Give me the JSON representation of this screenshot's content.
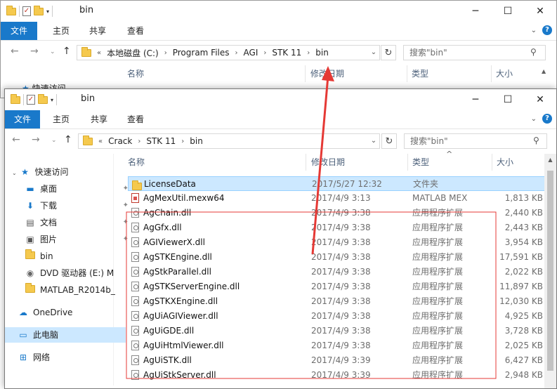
{
  "back_window": {
    "title": "bin",
    "ribbon_tabs": [
      "文件",
      "主页",
      "共享",
      "查看"
    ],
    "address_root_chevron": "«",
    "address": [
      "本地磁盘 (C:)",
      "Program Files",
      "AGI",
      "STK 11",
      "bin"
    ],
    "search_placeholder": "搜索\"bin\"",
    "columns": [
      "名称",
      "修改日期",
      "类型",
      "大小"
    ],
    "sidebar_partial": "快速访问"
  },
  "front_window": {
    "title": "bin",
    "ribbon_tabs": [
      "文件",
      "主页",
      "共享",
      "查看"
    ],
    "address_root_chevron": "«",
    "address": [
      "Crack",
      "STK 11",
      "bin"
    ],
    "search_placeholder": "搜索\"bin\"",
    "columns": {
      "name": "名称",
      "date": "修改日期",
      "type": "类型",
      "size": "大小"
    },
    "sidebar": [
      {
        "label": "快速访问",
        "icon": "star-icon",
        "pinned": false
      },
      {
        "label": "桌面",
        "icon": "desktop-icon",
        "pinned": true
      },
      {
        "label": "下载",
        "icon": "download-icon",
        "pinned": true
      },
      {
        "label": "文档",
        "icon": "document-icon",
        "pinned": true
      },
      {
        "label": "图片",
        "icon": "picture-icon",
        "pinned": true
      },
      {
        "label": "bin",
        "icon": "folder-icon",
        "pinned": false
      },
      {
        "label": "DVD 驱动器 (E:) M",
        "icon": "dvd-drive-icon",
        "pinned": false
      },
      {
        "label": "MATLAB_R2014b_",
        "icon": "folder-icon",
        "pinned": false
      },
      {
        "label": "OneDrive",
        "icon": "cloud-icon",
        "pinned": false
      },
      {
        "label": "此电脑",
        "icon": "computer-icon",
        "pinned": false
      },
      {
        "label": "网络",
        "icon": "network-icon",
        "pinned": false
      }
    ],
    "files": [
      {
        "name": "LicenseData",
        "date": "2017/5/27 12:32",
        "type": "文件夹",
        "size": "",
        "icon": "folder-icon"
      },
      {
        "name": "AgMexUtil.mexw64",
        "date": "2017/4/9 3:13",
        "type": "MATLAB MEX",
        "size": "1,813 KB",
        "icon": "matlab-file-icon"
      },
      {
        "name": "AgChain.dll",
        "date": "2017/4/9 3:38",
        "type": "应用程序扩展",
        "size": "2,440 KB",
        "icon": "dll-file-icon"
      },
      {
        "name": "AgGfx.dll",
        "date": "2017/4/9 3:38",
        "type": "应用程序扩展",
        "size": "2,443 KB",
        "icon": "dll-file-icon"
      },
      {
        "name": "AGIViewerX.dll",
        "date": "2017/4/9 3:38",
        "type": "应用程序扩展",
        "size": "3,954 KB",
        "icon": "dll-file-icon"
      },
      {
        "name": "AgSTKEngine.dll",
        "date": "2017/4/9 3:38",
        "type": "应用程序扩展",
        "size": "17,591 KB",
        "icon": "dll-file-icon"
      },
      {
        "name": "AgStkParallel.dll",
        "date": "2017/4/9 3:38",
        "type": "应用程序扩展",
        "size": "2,022 KB",
        "icon": "dll-file-icon"
      },
      {
        "name": "AgSTKServerEngine.dll",
        "date": "2017/4/9 3:38",
        "type": "应用程序扩展",
        "size": "11,897 KB",
        "icon": "dll-file-icon"
      },
      {
        "name": "AgSTKXEngine.dll",
        "date": "2017/4/9 3:38",
        "type": "应用程序扩展",
        "size": "12,030 KB",
        "icon": "dll-file-icon"
      },
      {
        "name": "AgUiAGIViewer.dll",
        "date": "2017/4/9 3:38",
        "type": "应用程序扩展",
        "size": "4,925 KB",
        "icon": "dll-file-icon"
      },
      {
        "name": "AgUiGDE.dll",
        "date": "2017/4/9 3:38",
        "type": "应用程序扩展",
        "size": "3,728 KB",
        "icon": "dll-file-icon"
      },
      {
        "name": "AgUiHtmlViewer.dll",
        "date": "2017/4/9 3:38",
        "type": "应用程序扩展",
        "size": "2,025 KB",
        "icon": "dll-file-icon"
      },
      {
        "name": "AgUiSTK.dll",
        "date": "2017/4/9 3:39",
        "type": "应用程序扩展",
        "size": "6,427 KB",
        "icon": "dll-file-icon"
      },
      {
        "name": "AgUiStkServer.dll",
        "date": "2017/4/9 3:39",
        "type": "应用程序扩展",
        "size": "2,948 KB",
        "icon": "dll-file-icon"
      }
    ]
  },
  "colors": {
    "accent": "#1979ca",
    "selection": "#cce8ff",
    "annotation_red": "#e53935"
  }
}
